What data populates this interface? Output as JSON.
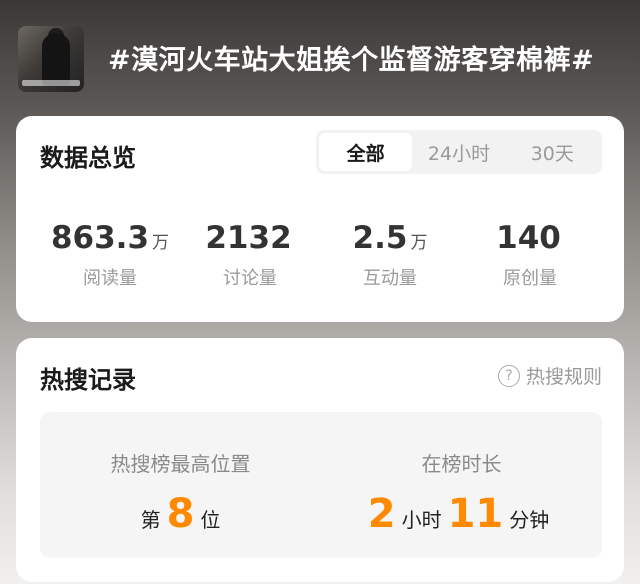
{
  "topic": {
    "title": "#漠河火车站大姐挨个监督游客穿棉裤#",
    "cover_icon": "topic-cover-image"
  },
  "overview": {
    "heading": "数据总览",
    "tabs": [
      {
        "label": "全部",
        "active": true
      },
      {
        "label": "24小时",
        "active": false
      },
      {
        "label": "30天",
        "active": false
      }
    ],
    "stats": [
      {
        "value": "863.3",
        "unit": "万",
        "label": "阅读量"
      },
      {
        "value": "2132",
        "unit": "",
        "label": "讨论量"
      },
      {
        "value": "2.5",
        "unit": "万",
        "label": "互动量"
      },
      {
        "value": "140",
        "unit": "",
        "label": "原创量"
      }
    ]
  },
  "hot_search": {
    "heading": "热搜记录",
    "rules_label": "热搜规则",
    "rules_icon": "question-circle-icon",
    "peak": {
      "label": "热搜榜最高位置",
      "prefix": "第",
      "value": "8",
      "suffix": "位"
    },
    "duration": {
      "label": "在榜时长",
      "hours": "2",
      "hours_unit": "小时",
      "minutes": "11",
      "minutes_unit": "分钟"
    }
  },
  "colors": {
    "accent": "#ff8a00",
    "card_bg": "#ffffff",
    "muted_text": "#9a9a9a"
  }
}
